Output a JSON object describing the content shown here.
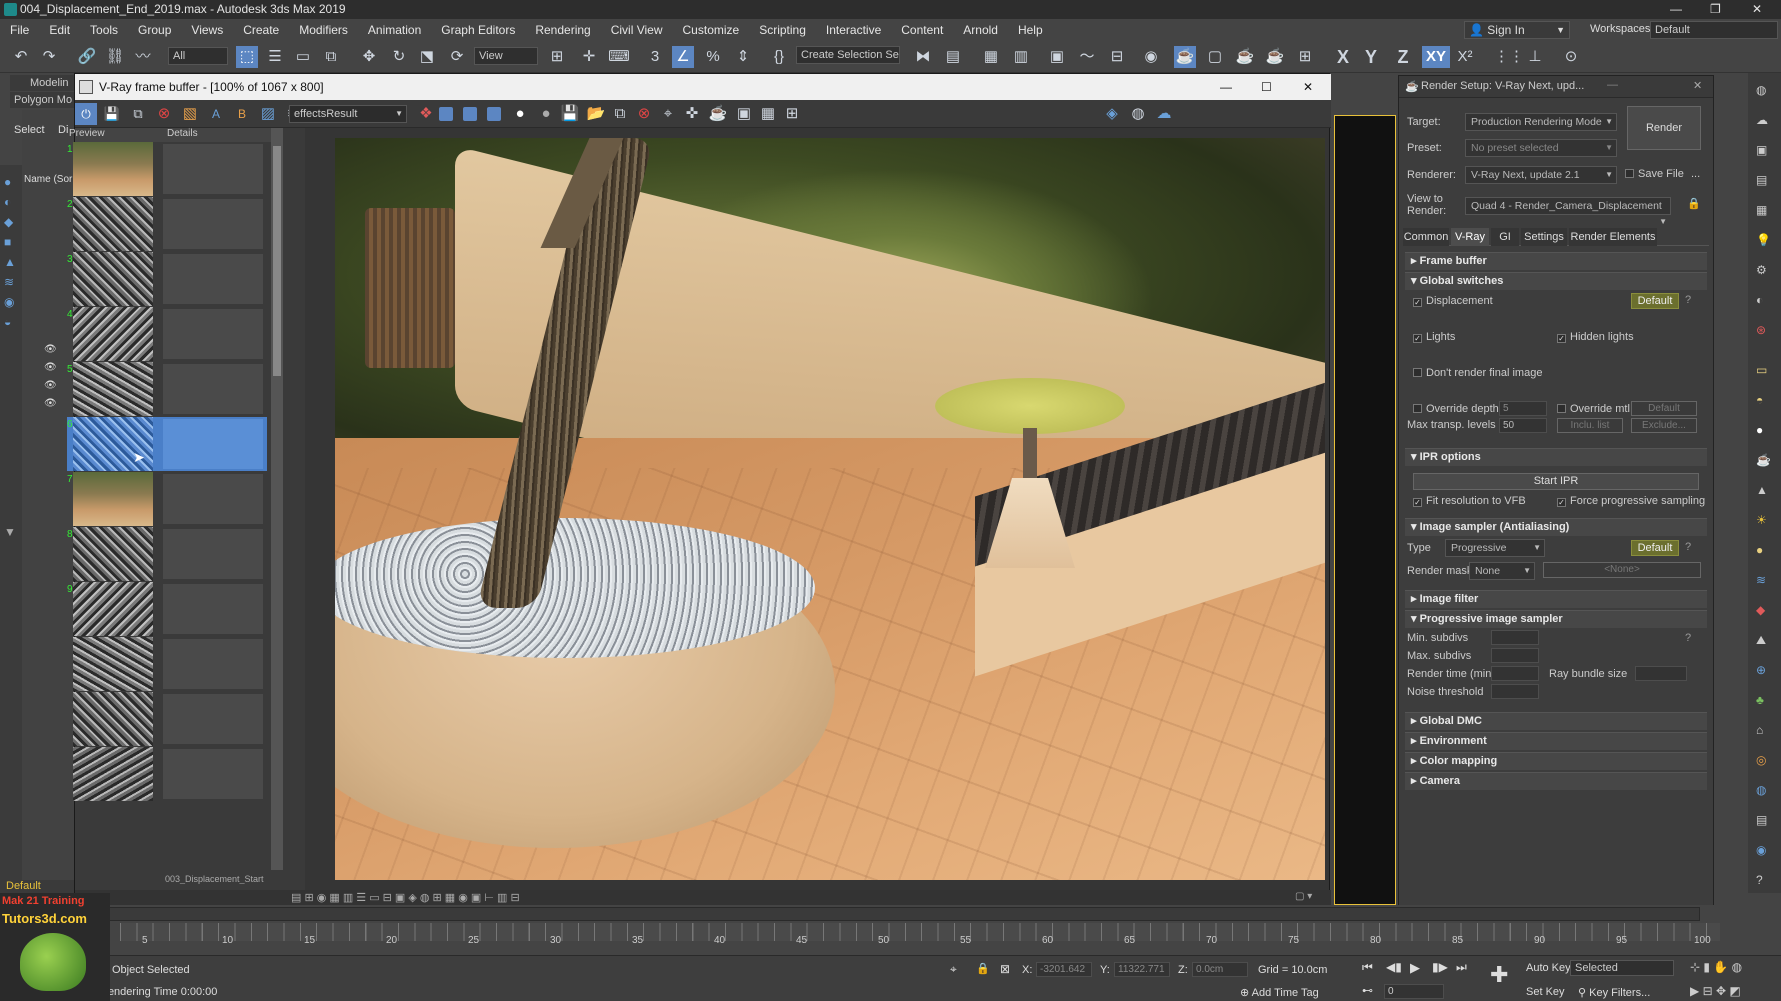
{
  "window": {
    "title": "004_Displacement_End_2019.max - Autodesk 3ds Max 2019"
  },
  "menu": [
    "File",
    "Edit",
    "Tools",
    "Group",
    "Views",
    "Create",
    "Modifiers",
    "Animation",
    "Graph Editors",
    "Rendering",
    "Civil View",
    "Customize",
    "Scripting",
    "Interactive",
    "Content",
    "Arnold",
    "Help"
  ],
  "account": {
    "sign_in": "Sign In",
    "workspaces_label": "Workspaces:",
    "workspace": "Default"
  },
  "toolbar": {
    "filter": "All",
    "view": "View",
    "selection_set": "Create Selection Se",
    "axes": [
      "X",
      "Y",
      "Z",
      "XY"
    ]
  },
  "ribbon": {
    "tab": "Modelin",
    "sub": "Polygon Mo"
  },
  "scene_explorer": {
    "select": "Select",
    "display": "Di",
    "column": "Name (Sor",
    "layer": "Default"
  },
  "vfb": {
    "title": "V-Ray frame buffer - [100% of 1067 x 800]",
    "channel": "effectsResult",
    "history_preview": "Preview",
    "history_details": "Details",
    "history_footer": "003_Displacement_Start",
    "history_numbers": [
      "1",
      "2",
      "3",
      "4",
      "5",
      "6",
      "7",
      "8",
      "9"
    ]
  },
  "render_setup": {
    "title": "Render Setup: V-Ray Next, upd...",
    "target_label": "Target:",
    "target": "Production Rendering Mode",
    "preset_label": "Preset:",
    "preset": "No preset selected",
    "renderer_label": "Renderer:",
    "renderer": "V-Ray Next, update 2.1",
    "save_file": "Save File",
    "view_label": "View to Render:",
    "view": "Quad 4 - Render_Camera_Displacement",
    "render_button": "Render",
    "tabs": [
      "Common",
      "V-Ray",
      "GI",
      "Settings",
      "Render Elements"
    ],
    "active_tab": "V-Ray",
    "sections": {
      "frame_buffer": "Frame buffer",
      "global_switches": "Global switches",
      "displacement": "Displacement",
      "default": "Default",
      "lights": "Lights",
      "hidden_lights": "Hidden lights",
      "dont_render": "Don't render final image",
      "override_depth": "Override depth",
      "override_depth_val": "5",
      "override_mtl": "Override mtl",
      "override_mtl_val": "Default",
      "max_transp": "Max transp. levels",
      "max_transp_val": "50",
      "incl_list": "Inclu. list",
      "exclude": "Exclude...",
      "ipr_options": "IPR options",
      "start_ipr": "Start IPR",
      "fit_res": "Fit resolution to VFB",
      "force_prog": "Force progressive sampling",
      "image_sampler": "Image sampler (Antialiasing)",
      "type_label": "Type",
      "type": "Progressive",
      "render_mask_label": "Render mask",
      "render_mask": "None",
      "render_mask_obj": "<None>",
      "image_filter": "Image filter",
      "prog_sampler": "Progressive image sampler",
      "min_subdivs": "Min. subdivs",
      "max_subdivs": "Max. subdivs",
      "render_time": "Render time (min)",
      "ray_bundle": "Ray bundle size",
      "noise_threshold": "Noise threshold",
      "global_dmc": "Global DMC",
      "environment": "Environment",
      "color_mapping": "Color mapping",
      "camera": "Camera"
    }
  },
  "timeline": {
    "ticks": [
      "5",
      "10",
      "15",
      "20",
      "25",
      "30",
      "35",
      "40",
      "45",
      "50",
      "55",
      "60",
      "65",
      "70",
      "75",
      "80",
      "85",
      "90",
      "95",
      "100"
    ]
  },
  "status": {
    "logo_line1": "Mak 21 Training",
    "logo_line2": "Tutors3d.com",
    "selection": "Object Selected",
    "render_time": "Rendering Time 0:00:00",
    "x_label": "X:",
    "x_val": "-3201.642",
    "y_label": "Y:",
    "y_val": "11322.771",
    "z_label": "Z:",
    "z_val": "0.0cm",
    "grid": "Grid = 10.0cm",
    "add_time_tag": "Add Time Tag",
    "auto_key": "Auto Key",
    "set_key": "Set Key",
    "selected": "Selected",
    "key_filters": "Key Filters...",
    "frame": "0"
  }
}
